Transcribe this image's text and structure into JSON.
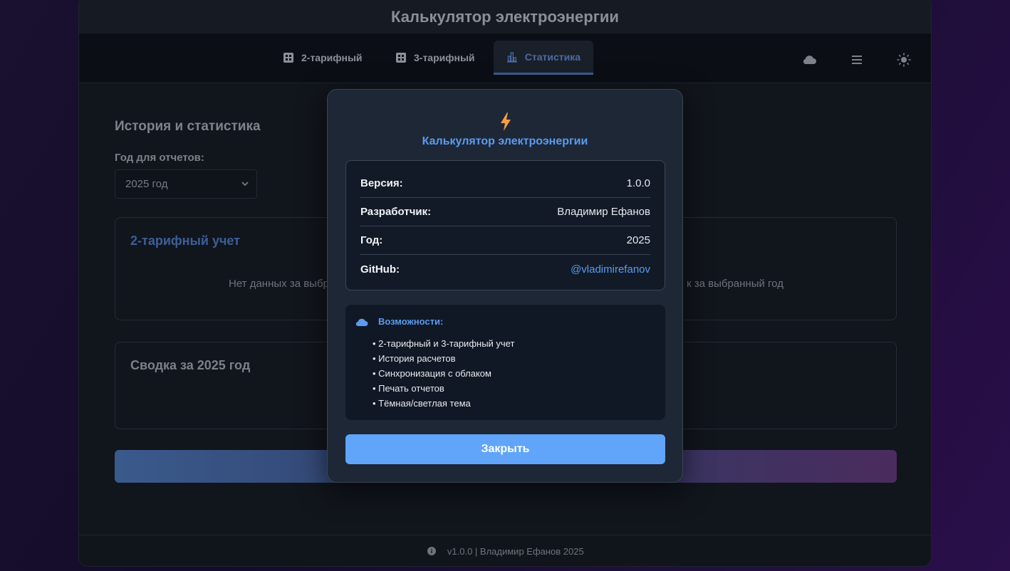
{
  "app": {
    "title": "Калькулятор электроэнергии"
  },
  "nav": {
    "tabs": [
      {
        "label": "2-тарифный",
        "icon": "grid-icon"
      },
      {
        "label": "3-тарифный",
        "icon": "grid-icon"
      },
      {
        "label": "Статистика",
        "icon": "bar-chart-icon",
        "active": true
      }
    ],
    "icons": [
      "cloud-icon",
      "menu-icon",
      "sun-icon"
    ]
  },
  "main": {
    "section_title": "История и статистика",
    "year_label": "Год для отчетов:",
    "year_selected": "2025 год",
    "card1": {
      "title": "2-тарифный учет",
      "nodata_left": "Нет данных за выбр",
      "nodata_right": "к за выбранный год"
    },
    "card2": {
      "title": "Сводка за 2025 год"
    }
  },
  "footer": {
    "text": "v1.0.0 | Владимир Ефанов 2025"
  },
  "modal": {
    "title": "Калькулятор электроэнергии",
    "info": [
      {
        "key": "Версия:",
        "value": "1.0.0"
      },
      {
        "key": "Разработчик:",
        "value": "Владимир Ефанов"
      },
      {
        "key": "Год:",
        "value": "2025"
      },
      {
        "key": "GitHub:",
        "value": "@vladimirefanov"
      }
    ],
    "features_title": "Возможности:",
    "features": [
      "2-тарифный и 3-тарифный учет",
      "История расчетов",
      "Синхронизация с облаком",
      "Печать отчетов",
      "Тёмная/светлая тема"
    ],
    "close_label": "Закрыть"
  },
  "colors": {
    "accent": "#60a5fa",
    "link": "#5b9bf0",
    "bolt": "#f59e42",
    "modal_bg": "#1e2735"
  }
}
